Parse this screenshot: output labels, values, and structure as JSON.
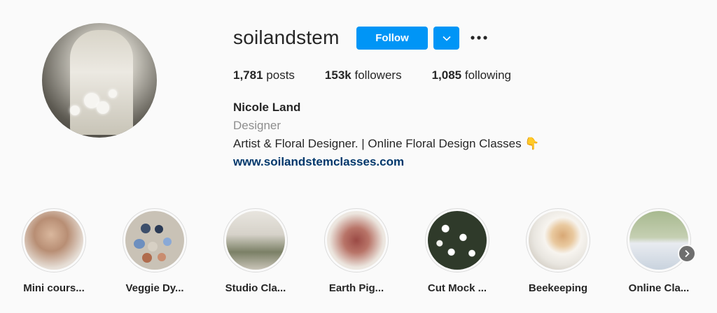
{
  "profile": {
    "username": "soilandstem",
    "follow_label": "Follow",
    "stats": {
      "posts_count": "1,781",
      "posts_label": "posts",
      "followers_count": "153k",
      "followers_label": "followers",
      "following_count": "1,085",
      "following_label": "following"
    },
    "full_name": "Nicole Land",
    "category": "Designer",
    "bio": "Artist & Floral Designer. | Online Floral Design Classes 👇",
    "website": "www.soilandstemclasses.com"
  },
  "highlights": [
    {
      "label": "Mini cours..."
    },
    {
      "label": "Veggie Dy..."
    },
    {
      "label": "Studio Cla..."
    },
    {
      "label": "Earth Pig..."
    },
    {
      "label": "Cut Mock ..."
    },
    {
      "label": "Beekeeping"
    },
    {
      "label": "Online Cla..."
    }
  ],
  "colors": {
    "accent": "#0095f6",
    "link": "#00376b",
    "muted": "#8e8e8e",
    "background": "#fafafa"
  },
  "icons": {
    "dropdown": "chevron-down-icon",
    "more": "more-horizontal-icon",
    "next": "chevron-right-icon"
  }
}
